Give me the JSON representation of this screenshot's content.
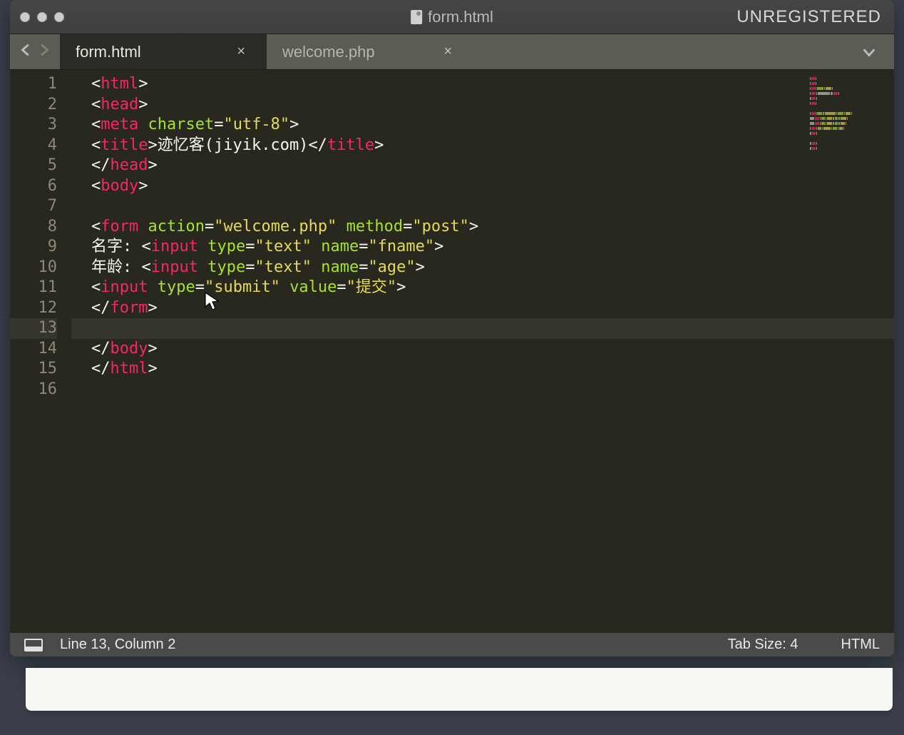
{
  "window": {
    "title_filename": "form.html",
    "unregistered_label": "UNREGISTERED"
  },
  "tabs": [
    {
      "label": "form.html",
      "active": true
    },
    {
      "label": "welcome.php",
      "active": false
    }
  ],
  "gutter_lines": [
    "1",
    "2",
    "3",
    "4",
    "5",
    "6",
    "7",
    "8",
    "9",
    "10",
    "11",
    "12",
    "13",
    "14",
    "15",
    "16"
  ],
  "active_line_index": 12,
  "code": {
    "lines": [
      {
        "segments": [
          {
            "t": "<",
            "c": "t-punct"
          },
          {
            "t": "html",
            "c": "t-tag"
          },
          {
            "t": ">",
            "c": "t-punct"
          }
        ]
      },
      {
        "segments": [
          {
            "t": "<",
            "c": "t-punct"
          },
          {
            "t": "head",
            "c": "t-tag"
          },
          {
            "t": ">",
            "c": "t-punct"
          }
        ]
      },
      {
        "segments": [
          {
            "t": "<",
            "c": "t-punct"
          },
          {
            "t": "meta",
            "c": "t-tag"
          },
          {
            "t": " ",
            "c": "t-text"
          },
          {
            "t": "charset",
            "c": "t-attr"
          },
          {
            "t": "=",
            "c": "t-punct"
          },
          {
            "t": "\"utf-8\"",
            "c": "t-str"
          },
          {
            "t": ">",
            "c": "t-punct"
          }
        ]
      },
      {
        "segments": [
          {
            "t": "<",
            "c": "t-punct"
          },
          {
            "t": "title",
            "c": "t-tag"
          },
          {
            "t": ">",
            "c": "t-punct"
          },
          {
            "t": "迹忆客(jiyik.com)",
            "c": "t-text"
          },
          {
            "t": "</",
            "c": "t-punct"
          },
          {
            "t": "title",
            "c": "t-tag"
          },
          {
            "t": ">",
            "c": "t-punct"
          }
        ]
      },
      {
        "segments": [
          {
            "t": "</",
            "c": "t-punct"
          },
          {
            "t": "head",
            "c": "t-tag"
          },
          {
            "t": ">",
            "c": "t-punct"
          }
        ]
      },
      {
        "segments": [
          {
            "t": "<",
            "c": "t-punct"
          },
          {
            "t": "body",
            "c": "t-tag"
          },
          {
            "t": ">",
            "c": "t-punct"
          }
        ]
      },
      {
        "segments": []
      },
      {
        "segments": [
          {
            "t": "<",
            "c": "t-punct"
          },
          {
            "t": "form",
            "c": "t-tag"
          },
          {
            "t": " ",
            "c": "t-text"
          },
          {
            "t": "action",
            "c": "t-attr"
          },
          {
            "t": "=",
            "c": "t-punct"
          },
          {
            "t": "\"welcome.php\"",
            "c": "t-str"
          },
          {
            "t": " ",
            "c": "t-text"
          },
          {
            "t": "method",
            "c": "t-attr"
          },
          {
            "t": "=",
            "c": "t-punct"
          },
          {
            "t": "\"post\"",
            "c": "t-str"
          },
          {
            "t": ">",
            "c": "t-punct"
          }
        ]
      },
      {
        "segments": [
          {
            "t": "名字: <",
            "c": "t-punct"
          },
          {
            "t": "input",
            "c": "t-tag"
          },
          {
            "t": " ",
            "c": "t-text"
          },
          {
            "t": "type",
            "c": "t-attr"
          },
          {
            "t": "=",
            "c": "t-punct"
          },
          {
            "t": "\"text\"",
            "c": "t-str"
          },
          {
            "t": " ",
            "c": "t-text"
          },
          {
            "t": "name",
            "c": "t-attr"
          },
          {
            "t": "=",
            "c": "t-punct"
          },
          {
            "t": "\"fname\"",
            "c": "t-str"
          },
          {
            "t": ">",
            "c": "t-punct"
          }
        ]
      },
      {
        "segments": [
          {
            "t": "年龄: <",
            "c": "t-punct"
          },
          {
            "t": "input",
            "c": "t-tag"
          },
          {
            "t": " ",
            "c": "t-text"
          },
          {
            "t": "type",
            "c": "t-attr"
          },
          {
            "t": "=",
            "c": "t-punct"
          },
          {
            "t": "\"text\"",
            "c": "t-str"
          },
          {
            "t": " ",
            "c": "t-text"
          },
          {
            "t": "name",
            "c": "t-attr"
          },
          {
            "t": "=",
            "c": "t-punct"
          },
          {
            "t": "\"age\"",
            "c": "t-str"
          },
          {
            "t": ">",
            "c": "t-punct"
          }
        ]
      },
      {
        "segments": [
          {
            "t": "<",
            "c": "t-punct"
          },
          {
            "t": "input",
            "c": "t-tag"
          },
          {
            "t": " ",
            "c": "t-text"
          },
          {
            "t": "type",
            "c": "t-attr"
          },
          {
            "t": "=",
            "c": "t-punct"
          },
          {
            "t": "\"submit\"",
            "c": "t-str"
          },
          {
            "t": " ",
            "c": "t-text"
          },
          {
            "t": "value",
            "c": "t-attr"
          },
          {
            "t": "=",
            "c": "t-punct"
          },
          {
            "t": "\"提交\"",
            "c": "t-str"
          },
          {
            "t": ">",
            "c": "t-punct"
          }
        ]
      },
      {
        "segments": [
          {
            "t": "</",
            "c": "t-punct"
          },
          {
            "t": "form",
            "c": "t-tag"
          },
          {
            "t": ">",
            "c": "t-punct"
          }
        ]
      },
      {
        "segments": []
      },
      {
        "segments": [
          {
            "t": "</",
            "c": "t-punct"
          },
          {
            "t": "body",
            "c": "t-tag"
          },
          {
            "t": ">",
            "c": "t-punct"
          }
        ]
      },
      {
        "segments": [
          {
            "t": "</",
            "c": "t-punct"
          },
          {
            "t": "html",
            "c": "t-tag"
          },
          {
            "t": ">",
            "c": "t-punct"
          }
        ]
      },
      {
        "segments": []
      }
    ]
  },
  "statusbar": {
    "position": "Line 13, Column 2",
    "tab_size": "Tab Size: 4",
    "syntax": "HTML"
  }
}
